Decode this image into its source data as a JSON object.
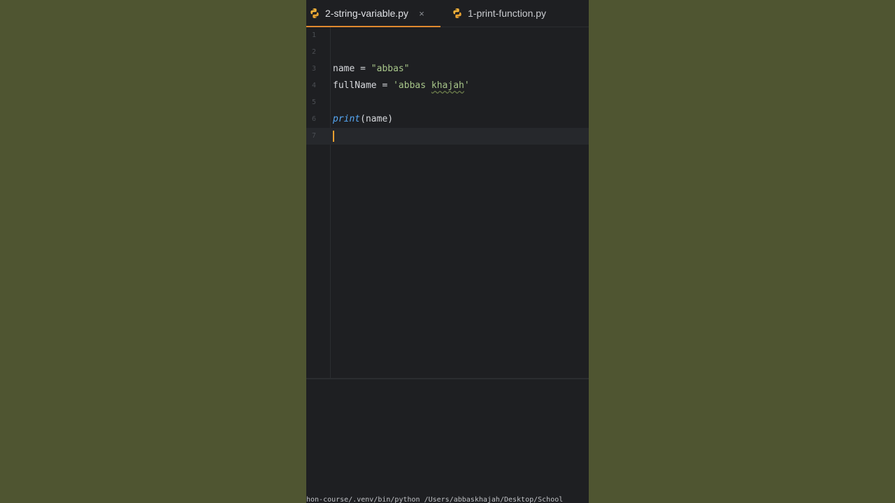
{
  "tabs": [
    {
      "label": "2-string-variable.py",
      "active": true,
      "icon": "python-icon",
      "close": "×"
    },
    {
      "label": "1-print-function.py",
      "active": false,
      "icon": "python-icon"
    }
  ],
  "editor": {
    "line_numbers": [
      "1",
      "2",
      "3",
      "4",
      "5",
      "6",
      "7"
    ],
    "lines": {
      "l3": {
        "var": "name",
        "op": " = ",
        "str": "\"abbas\""
      },
      "l4": {
        "var": "fullName",
        "op": " = ",
        "str_a": "'abbas ",
        "str_b": "khajah",
        "str_c": "'"
      },
      "l6": {
        "fn": "print",
        "open": "(",
        "arg": "name",
        "close": ")"
      }
    }
  },
  "terminal": {
    "command": "hon-course/.venv/bin/python /Users/abbaskhajah/Desktop/School"
  },
  "colors": {
    "background": "#4f5531",
    "accent": "#e08a2f",
    "string": "#a7c589",
    "function": "#56a8f5"
  }
}
